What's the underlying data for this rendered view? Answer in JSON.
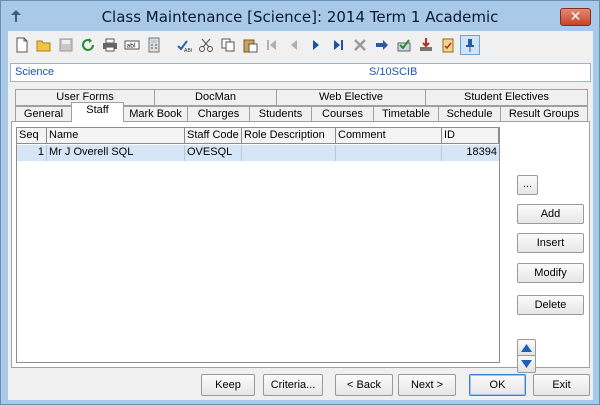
{
  "window": {
    "title": "Class Maintenance  [Science]: 2014 Term 1 Academic",
    "close_label": "✕"
  },
  "context": {
    "left": "Science",
    "right": "S/10SCIB"
  },
  "tabs_row1": [
    {
      "label": "User Forms"
    },
    {
      "label": "DocMan"
    },
    {
      "label": "Web Elective"
    },
    {
      "label": "Student Electives"
    }
  ],
  "tabs_row2": [
    {
      "label": "General"
    },
    {
      "label": "Staff"
    },
    {
      "label": "Mark Book"
    },
    {
      "label": "Charges"
    },
    {
      "label": "Students"
    },
    {
      "label": "Courses"
    },
    {
      "label": "Timetable"
    },
    {
      "label": "Schedule"
    },
    {
      "label": "Result Groups"
    }
  ],
  "active_tab": "Staff",
  "grid": {
    "columns": [
      "Seq",
      "Name",
      "Staff Code",
      "Role Description",
      "Comment",
      "ID"
    ],
    "rows": [
      {
        "seq": "1",
        "name": "Mr J Overell SQL",
        "staff_code": "OVESQL",
        "role": "",
        "comment": "",
        "id": "18394"
      }
    ]
  },
  "side_buttons": {
    "dots": "...",
    "add": "Add",
    "insert": "Insert",
    "modify": "Modify",
    "delete": "Delete"
  },
  "bottom_buttons": {
    "keep": "Keep",
    "criteria": "Criteria...",
    "back": "< Back",
    "next": "Next >",
    "ok": "OK",
    "exit": "Exit"
  },
  "toolbar_icons": [
    "new-icon",
    "open-icon",
    "save-icon",
    "refresh-icon",
    "print-icon",
    "form-field-icon",
    "calculator-icon",
    "spellcheck-icon",
    "cut-icon",
    "copy-icon",
    "paste-icon",
    "first-icon",
    "previous-icon",
    "next-icon",
    "last-icon",
    "delete-icon",
    "goto-icon",
    "approve-icon",
    "export-icon",
    "clipboard-check-icon",
    "pin-icon"
  ]
}
